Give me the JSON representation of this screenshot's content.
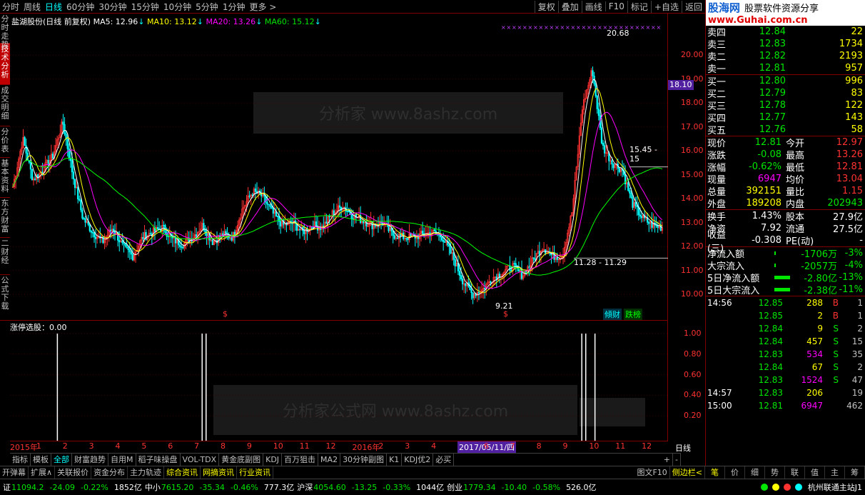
{
  "topbar": {
    "tabs": [
      "分时",
      "周线",
      "日线",
      "60分钟",
      "30分钟",
      "15分钟",
      "10分钟",
      "5分钟",
      "1分钟",
      "更多 >"
    ],
    "right_buttons": [
      "复权",
      "叠加",
      "画线",
      "F10",
      "标记",
      "+自选",
      "返回"
    ]
  },
  "leftnav": [
    "分时走势",
    "技术分析",
    "成交明细",
    "分价表",
    "基本资料",
    "东方财富",
    "二财经",
    "公式下载"
  ],
  "chart_header": {
    "stock": "盐湖股份(日线 前复权)",
    "ma5": "MA5: 12.96",
    "ma10": "MA10: 13.12",
    "ma20": "MA20: 13.26",
    "ma60": "MA60: 15.12"
  },
  "annotations": {
    "high": "20.68",
    "low": "9.21",
    "range1": "15.45 - 15",
    "range2": "11.28 - 11.29",
    "price_tag": "18.10",
    "tag1": "傾财",
    "tag2": "跌榜",
    "watermark1": "分析家 www.8ashz.com",
    "watermark2": "分析家公式网 www.8ashz.com",
    "sub_title": "涨停选股：0.00",
    "period_label": "日线",
    "dollar": "$"
  },
  "colors": {
    "ma5": "#ffffff",
    "ma10": "#ffff00",
    "ma20": "#ff00ff",
    "ma60": "#00ff00",
    "up": "#ff3232",
    "down": "#00ffff"
  },
  "chart_data": {
    "type": "candlestick",
    "title": "盐湖股份(日线 前复权)",
    "y_axis_labels": [
      "20.00",
      "19.00",
      "18.00",
      "17.00",
      "16.00",
      "15.00",
      "14.00",
      "13.00",
      "12.00",
      "11.00",
      "10.00"
    ],
    "ylim": [
      9.5,
      20.9
    ],
    "close_profile": [
      14.5,
      16.5,
      14.8,
      15.2,
      15.8,
      17.2,
      15.0,
      13.2,
      12.6,
      12.2,
      12.8,
      12.0,
      11.6,
      12.4,
      12.6,
      12.8,
      12.3,
      12.1,
      12.4,
      12.9,
      12.2,
      12.5,
      12.4,
      13.6,
      14.3,
      14.1,
      13.4,
      12.9,
      13.0,
      12.6,
      12.9,
      12.8,
      13.4,
      13.7,
      13.3,
      13.1,
      12.9,
      13.0,
      12.5,
      12.4,
      12.4,
      12.5,
      12.6,
      12.4,
      11.6,
      10.6,
      10.0,
      10.2,
      10.7,
      10.9,
      11.2,
      10.8,
      11.4,
      12.0,
      11.6,
      11.6,
      13.5,
      17.8,
      19.4,
      16.2,
      15.5,
      15.2,
      13.8,
      13.2,
      12.9,
      12.8
    ],
    "sub_chart": {
      "title": "涨停选股：0.00",
      "y_axis_labels": [
        "1.00",
        "0.80",
        "0.60",
        "0.40",
        "0.20"
      ],
      "spikes_at": [
        0.072,
        0.292,
        0.298,
        0.869,
        0.875,
        0.889
      ]
    },
    "x_ticks": [
      "2015年",
      "1",
      "2",
      "3",
      "4",
      "5",
      "6",
      "7",
      "8",
      "9",
      "10",
      "11",
      "12",
      "2016年",
      "2",
      "3",
      "4",
      "2017/05/11/四",
      "6",
      "7",
      "8",
      "9",
      "10",
      "11",
      "12"
    ]
  },
  "indicator_tabs": [
    "指标",
    "模板",
    "全部",
    "财富趋势",
    "自用M",
    "稻子味操盘",
    "VOL-TDX",
    "黄金底副图",
    "KDJ",
    "百万狙击",
    "MA2",
    "30分钟副图",
    "K1",
    "KDJ优2",
    "必买"
  ],
  "bottom_tabs": [
    "开弹幕",
    "扩展∧",
    "关联报价",
    "资金分布",
    "主力轨迹",
    "综合资讯",
    "网摘资讯",
    "行业资讯"
  ],
  "bottom_right": [
    "图文F10",
    "侧边栏<"
  ],
  "panel_brand": {
    "left": "股海网",
    "right": "股票软件资源分享",
    "url": "www.Guhai.com.cn"
  },
  "sell": [
    {
      "k": "卖四",
      "p": "12.84",
      "v": "22"
    },
    {
      "k": "卖三",
      "p": "12.83",
      "v": "1734"
    },
    {
      "k": "卖二",
      "p": "12.82",
      "v": "2193"
    },
    {
      "k": "卖一",
      "p": "12.81",
      "v": "957"
    }
  ],
  "buy": [
    {
      "k": "买一",
      "p": "12.80",
      "v": "996"
    },
    {
      "k": "买二",
      "p": "12.79",
      "v": "83"
    },
    {
      "k": "买三",
      "p": "12.78",
      "v": "122"
    },
    {
      "k": "买四",
      "p": "12.77",
      "v": "143"
    },
    {
      "k": "买五",
      "p": "12.76",
      "v": "58"
    }
  ],
  "quote": [
    {
      "k1": "现价",
      "v1": "12.81",
      "k2": "今开",
      "v2": "12.97"
    },
    {
      "k1": "涨跌",
      "v1": "-0.08",
      "k2": "最高",
      "v2": "13.26"
    },
    {
      "k1": "涨幅",
      "v1": "-0.62%",
      "k2": "最低",
      "v2": "12.81"
    },
    {
      "k1": "现量",
      "v1": "6947",
      "k2": "均价",
      "v2": "13.04"
    },
    {
      "k1": "总量",
      "v1": "392151",
      "k2": "量比",
      "v2": "1.15"
    },
    {
      "k1": "外盘",
      "v1": "189208",
      "k2": "内盘",
      "v2": "202943"
    }
  ],
  "fund": [
    {
      "k1": "换手",
      "v1": "1.43%",
      "k2": "股本",
      "v2": "27.9亿"
    },
    {
      "k1": "净资",
      "v1": "7.92",
      "k2": "流通",
      "v2": "27.5亿"
    },
    {
      "k1": "收益(三)",
      "v1": "-0.308",
      "k2": "PE(动)",
      "v2": "-"
    }
  ],
  "flow": [
    {
      "k": "净流入额",
      "v": "-1706万",
      "pct": "-3%"
    },
    {
      "k": "大宗流入",
      "v": "-2057万",
      "pct": "-4%"
    },
    {
      "k": "5日净流入额",
      "v": "-2.80亿",
      "pct": "-13%"
    },
    {
      "k": "5日大宗流入",
      "v": "-2.38亿",
      "pct": "-11%"
    }
  ],
  "ticks": [
    {
      "t": "14:56",
      "p": "12.85",
      "v": "288",
      "f": "B",
      "e": "1"
    },
    {
      "t": "",
      "p": "12.85",
      "v": "2",
      "f": "B",
      "e": "1"
    },
    {
      "t": "",
      "p": "12.84",
      "v": "9",
      "f": "S",
      "e": "2"
    },
    {
      "t": "",
      "p": "12.84",
      "v": "457",
      "f": "S",
      "e": "15"
    },
    {
      "t": "",
      "p": "12.83",
      "v": "534",
      "f": "S",
      "e": "35"
    },
    {
      "t": "",
      "p": "12.84",
      "v": "67",
      "f": "S",
      "e": "2"
    },
    {
      "t": "",
      "p": "12.83",
      "v": "1524",
      "f": "S",
      "e": "47"
    },
    {
      "t": "14:57",
      "p": "12.83",
      "v": "206",
      "f": "",
      "e": "19"
    },
    {
      "t": "15:00",
      "p": "12.81",
      "v": "6947",
      "f": "",
      "e": "462"
    }
  ],
  "panel_tabs": [
    "笔",
    "价",
    "细",
    "势",
    "联",
    "值",
    "主",
    "筹"
  ],
  "status": [
    {
      "name": "证",
      "val": "11094.2",
      "chg": "-24.09",
      "pct": "-0.22%",
      "amt": "1852亿"
    },
    {
      "name": "中小",
      "val": "7615.20",
      "chg": "-35.34",
      "pct": "-0.46%",
      "amt": "777.3亿"
    },
    {
      "name": "沪深",
      "val": "4054.60",
      "chg": "-13.25",
      "pct": "-0.33%",
      "amt": "1044亿"
    },
    {
      "name": "创业",
      "val": "1779.34",
      "chg": "-10.40",
      "pct": "-0.58%",
      "amt": "526.0亿"
    }
  ],
  "status_station": "杭州联通主站J1"
}
